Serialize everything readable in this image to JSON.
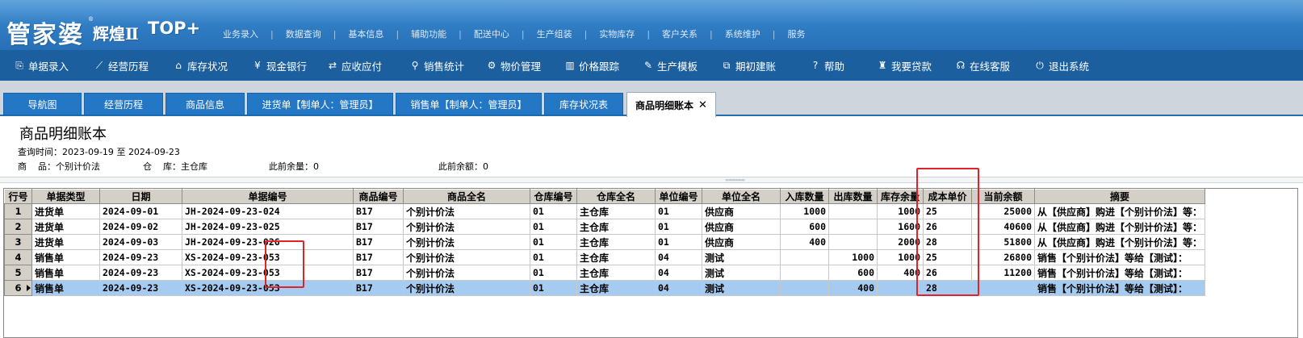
{
  "app": {
    "logo_main": "管家婆",
    "logo_sub": "辉煌Ⅱ",
    "logo_top": "TOP+",
    "logo_reg": "®"
  },
  "top_menu": [
    "业务录入",
    "数据查询",
    "基本信息",
    "辅助功能",
    "配送中心",
    "生产组装",
    "实物库存",
    "客户关系",
    "系统维护",
    "服务"
  ],
  "top_menu_sep": "|",
  "toolbar": [
    {
      "label": "单据录入",
      "icon": "document-edit-icon",
      "glyph": "⎘"
    },
    {
      "label": "经营历程",
      "icon": "line-chart-icon",
      "glyph": "⟋"
    },
    {
      "label": "库存状况",
      "icon": "home-icon",
      "glyph": "⌂"
    },
    {
      "label": "现金银行",
      "icon": "yen-icon",
      "glyph": "¥"
    },
    {
      "label": "应收应付",
      "icon": "arrows-exchange-icon",
      "glyph": "⇄"
    },
    {
      "label": "销售统计",
      "icon": "search-icon",
      "glyph": "⚲"
    },
    {
      "label": "物价管理",
      "icon": "gear-icon",
      "glyph": "⚙"
    },
    {
      "label": "价格跟踪",
      "icon": "bar-chart-icon",
      "glyph": "▥"
    },
    {
      "label": "生产模板",
      "icon": "wrench-icon",
      "glyph": "✎"
    },
    {
      "label": "期初建账",
      "icon": "external-link-icon",
      "glyph": "⧉"
    },
    {
      "label": "帮助",
      "icon": "help-icon",
      "glyph": "?"
    },
    {
      "label": "我要贷款",
      "icon": "money-bag-icon",
      "glyph": "♜"
    },
    {
      "label": "在线客服",
      "icon": "headset-icon",
      "glyph": "☊"
    },
    {
      "label": "退出系统",
      "icon": "power-icon",
      "glyph": "⏻"
    }
  ],
  "tabs": [
    "导航图",
    "经营历程",
    "商品信息",
    "进货单【制单人：管理员】",
    "销售单【制单人：管理员】",
    "库存状况表",
    "商品明细账本"
  ],
  "tab_close": "✕",
  "report": {
    "title": "商品明细账本",
    "query_label": "查询时间：",
    "date_from": "2023-09-19",
    "date_to_word": "至",
    "date_to": "2024-09-23",
    "product_label": "商    品：",
    "product_value": "个别计价法",
    "warehouse_label": "仓    库：",
    "warehouse_value": "主仓库",
    "prev_qty_label": "此前余量：",
    "prev_qty_value": "0",
    "prev_amt_label": "此前余额：",
    "prev_amt_value": "0"
  },
  "splitter_grip": "»»»»»»»»»",
  "table": {
    "columns": [
      "行号",
      "单据类型",
      "日期",
      "单据编号",
      "商品编号",
      "商品全名",
      "仓库编号",
      "仓库全名",
      "单位编号",
      "单位全名",
      "入库数量",
      "出库数量",
      "库存余量",
      "成本单价",
      "当前余额",
      "摘要"
    ],
    "rows": [
      [
        "1",
        "进货单",
        "2024-09-01",
        "JH-2024-09-23-024",
        "B17",
        "个别计价法",
        "01",
        "主仓库",
        "01",
        "供应商",
        "1000",
        "",
        "1000",
        "25",
        "25000",
        "从【供应商】购进【个别计价法】等："
      ],
      [
        "2",
        "进货单",
        "2024-09-02",
        "JH-2024-09-23-025",
        "B17",
        "个别计价法",
        "01",
        "主仓库",
        "01",
        "供应商",
        "600",
        "",
        "1600",
        "26",
        "40600",
        "从【供应商】购进【个别计价法】等："
      ],
      [
        "3",
        "进货单",
        "2024-09-03",
        "JH-2024-09-23-026",
        "B17",
        "个别计价法",
        "01",
        "主仓库",
        "01",
        "供应商",
        "400",
        "",
        "2000",
        "28",
        "51800",
        "从【供应商】购进【个别计价法】等："
      ],
      [
        "4",
        "销售单",
        "2024-09-23",
        "XS-2024-09-23-053",
        "B17",
        "个别计价法",
        "01",
        "主仓库",
        "04",
        "测试",
        "",
        "1000",
        "1000",
        "25",
        "26800",
        "销售【个别计价法】等给【测试】："
      ],
      [
        "5",
        "销售单",
        "2024-09-23",
        "XS-2024-09-23-053",
        "B17",
        "个别计价法",
        "01",
        "主仓库",
        "04",
        "测试",
        "",
        "600",
        "400",
        "26",
        "11200",
        "销售【个别计价法】等给【测试】："
      ],
      [
        "6",
        "销售单",
        "2024-09-23",
        "XS-2024-09-23-053",
        "B17",
        "个别计价法",
        "01",
        "主仓库",
        "04",
        "测试",
        "",
        "400",
        "",
        "28",
        "",
        "销售【个别计价法】等给【测试】："
      ]
    ],
    "selected_row": 6
  },
  "colors": {
    "header_blue": "#2f7cc3",
    "toolbar_blue": "#1b5f9e",
    "tab_blue": "#2477c5",
    "selected_row": "#a6cbf0",
    "highlight_red": "#e0232b"
  }
}
